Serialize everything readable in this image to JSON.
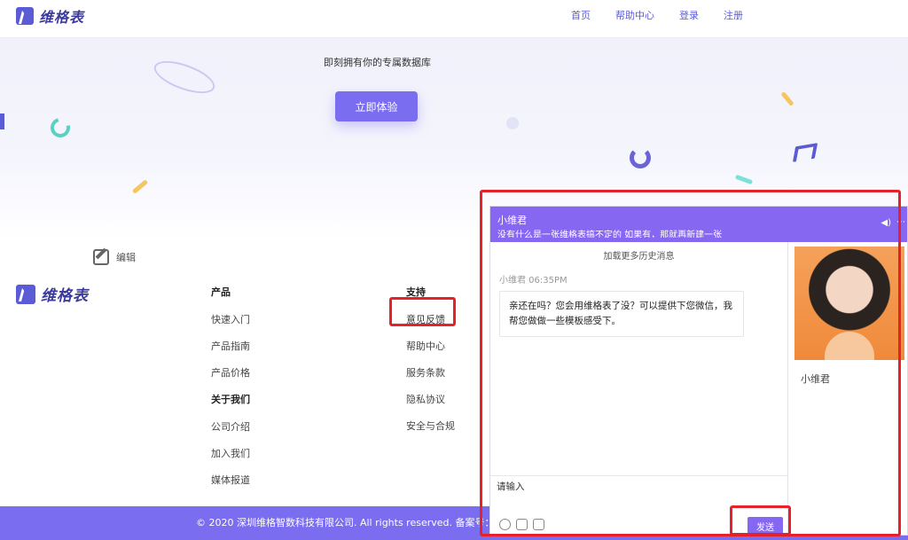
{
  "header": {
    "brand": "维格表",
    "nav": [
      {
        "label": "首页"
      },
      {
        "label": "帮助中心"
      },
      {
        "label": "登录"
      },
      {
        "label": "注册"
      }
    ]
  },
  "hero": {
    "tagline": "即刻拥有你的专属数据库",
    "cta_label": "立即体验",
    "edit_label": "编辑"
  },
  "footer": {
    "brand": "维格表",
    "product": {
      "title": "产品",
      "links": [
        "快速入门",
        "产品指南",
        "产品价格"
      ]
    },
    "about": {
      "title": "关于我们",
      "links": [
        "公司介绍",
        "加入我们",
        "媒体报道"
      ]
    },
    "support": {
      "title": "支持",
      "links": [
        "意见反馈",
        "帮助中心",
        "服务条款",
        "隐私协议",
        "安全与合规"
      ]
    },
    "copyright": "© 2020 深圳维格智数科技有限公司. All rights reserved. 备案号：粤IC"
  },
  "chat": {
    "agent_name": "小维君",
    "marquee": "没有什么是一张维格表搞不定的 如果有，那就再新建一张",
    "load_history": "加载更多历史消息",
    "message_meta": "小维君 06:35PM",
    "message_text": "亲还在吗？您会用维格表了没？可以提供下您微信，我帮您做做一些模板感受下。",
    "input_placeholder": "请输入",
    "send_label": "发送",
    "side_name": "小维君"
  },
  "colors": {
    "brand": "#5b5bd6",
    "accent": "#7a6df0",
    "chat_header": "#8667f2",
    "highlight": "#e6212a"
  }
}
